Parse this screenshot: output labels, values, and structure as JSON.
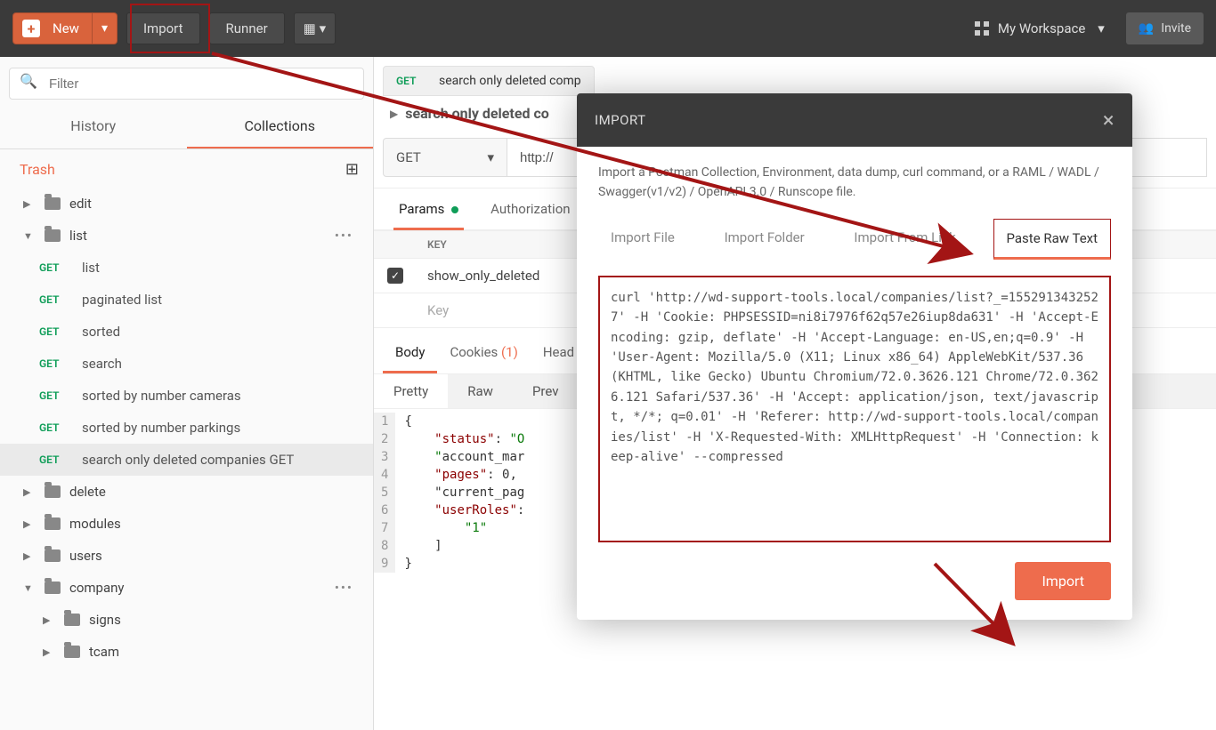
{
  "topbar": {
    "new_label": "New",
    "import_label": "Import",
    "runner_label": "Runner",
    "workspace": "My Workspace",
    "invite": "Invite"
  },
  "sidebar": {
    "filter_placeholder": "Filter",
    "tabs": {
      "history": "History",
      "collections": "Collections"
    },
    "trash": "Trash",
    "tree": [
      {
        "type": "folder",
        "open": false,
        "label": "edit"
      },
      {
        "type": "folder",
        "open": true,
        "label": "list",
        "dots": true
      },
      {
        "type": "req",
        "method": "GET",
        "label": "list"
      },
      {
        "type": "req",
        "method": "GET",
        "label": "paginated list"
      },
      {
        "type": "req",
        "method": "GET",
        "label": "sorted"
      },
      {
        "type": "req",
        "method": "GET",
        "label": "search"
      },
      {
        "type": "req",
        "method": "GET",
        "label": "sorted by number cameras"
      },
      {
        "type": "req",
        "method": "GET",
        "label": "sorted by number parkings"
      },
      {
        "type": "req",
        "method": "GET",
        "label": "search only deleted companies GET",
        "selected": true
      },
      {
        "type": "folder",
        "open": false,
        "label": "delete"
      },
      {
        "type": "folder",
        "open": false,
        "label": "modules"
      },
      {
        "type": "folder",
        "open": false,
        "label": "users"
      },
      {
        "type": "folder",
        "open": true,
        "label": "company",
        "dots": true
      },
      {
        "type": "subfolder",
        "open": false,
        "label": "signs"
      },
      {
        "type": "subfolder",
        "open": false,
        "label": "tcam"
      }
    ]
  },
  "request": {
    "tab_method": "GET",
    "tab_title": "search only deleted comp",
    "breadcrumb": "search only deleted co",
    "method": "GET",
    "url": "http://",
    "tabs": {
      "params": "Params",
      "auth": "Authorization"
    },
    "params_header": {
      "key": "KEY"
    },
    "param1": {
      "key": "show_only_deleted"
    },
    "param_placeholder": "Key"
  },
  "response": {
    "tabs": {
      "body": "Body",
      "cookies": "Cookies",
      "cookies_count": "(1)",
      "headers": "Head"
    },
    "view": {
      "pretty": "Pretty",
      "raw": "Raw",
      "preview": "Prev"
    },
    "lines": [
      "1",
      "2",
      "3",
      "4",
      "5",
      "6",
      "7",
      "8",
      "9"
    ],
    "body": "{\n    \"status\": \"O\n    \"account_mar\n    \"pages\": 0,\n    \"current_pag\n    \"userRoles\":\n        \"1\"\n    ]\n}"
  },
  "modal": {
    "title": "IMPORT",
    "description": "Import a Postman Collection, Environment, data dump, curl command, or a RAML / WADL / Swagger(v1/v2) / OpenAPI 3.0 / Runscope file.",
    "tabs": {
      "file": "Import File",
      "folder": "Import Folder",
      "link": "Import From Link",
      "raw": "Paste Raw Text"
    },
    "raw_text": "curl 'http://wd-support-tools.local/companies/list?_=1552913432527' -H 'Cookie: PHPSESSID=ni8i7976f62q57e26iup8da631' -H 'Accept-Encoding: gzip, deflate' -H 'Accept-Language: en-US,en;q=0.9' -H 'User-Agent: Mozilla/5.0 (X11; Linux x86_64) AppleWebKit/537.36 (KHTML, like Gecko) Ubuntu Chromium/72.0.3626.121 Chrome/72.0.3626.121 Safari/537.36' -H 'Accept: application/json, text/javascript, */*; q=0.01' -H 'Referer: http://wd-support-tools.local/companies/list' -H 'X-Requested-With: XMLHttpRequest' -H 'Connection: keep-alive' --compressed",
    "import_btn": "Import"
  }
}
